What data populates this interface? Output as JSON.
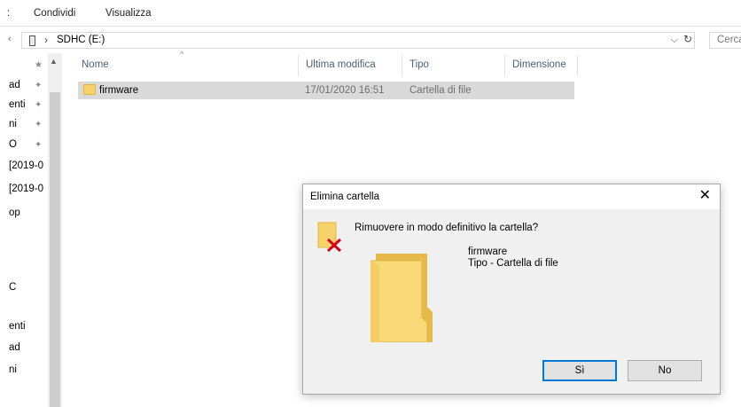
{
  "ribbon": {
    "tabs": [
      ":",
      "Condividi",
      "Visualizza"
    ]
  },
  "address": {
    "path": "SDHC (E:)",
    "separator": "›",
    "back_glyph": "‹",
    "dropdown_glyph": "⌵",
    "refresh_glyph": "↻",
    "search_placeholder": "Cerca"
  },
  "nav": {
    "items": [
      {
        "label": "ad",
        "pinned": true
      },
      {
        "label": "enti",
        "pinned": true
      },
      {
        "label": "ni",
        "pinned": true
      },
      {
        "label": "O",
        "pinned": true
      },
      {
        "label": "[2019-0",
        "pinned": false
      },
      {
        "label": "[2019-0",
        "pinned": false
      },
      {
        "label": "op",
        "pinned": false
      },
      {
        "label": "C",
        "pinned": false
      },
      {
        "label": "enti",
        "pinned": false
      },
      {
        "label": "ad",
        "pinned": false
      },
      {
        "label": "ni",
        "pinned": false
      }
    ],
    "top_pin_glyph": "★",
    "pin_glyph": "✦",
    "scroll_up_glyph": "▲"
  },
  "columns": {
    "name": "Nome",
    "modified": "Ultima modifica",
    "type": "Tipo",
    "size": "Dimensione",
    "sort_glyph": "^"
  },
  "files": [
    {
      "name": "firmware",
      "modified": "17/01/2020 16:51",
      "type": "Cartella di file"
    }
  ],
  "dialog": {
    "title": "Elimina cartella",
    "close_glyph": "✕",
    "question": "Rimuovere in modo definitivo la cartella?",
    "item_name": "firmware",
    "item_type": "Tipo - Cartella di file",
    "yes_label": "Sì",
    "no_label": "No"
  },
  "colors": {
    "folder": "#f6d36a",
    "delete_x": "#d6001c",
    "primary_border": "#0078d7",
    "selection": "#d9d9d9"
  }
}
